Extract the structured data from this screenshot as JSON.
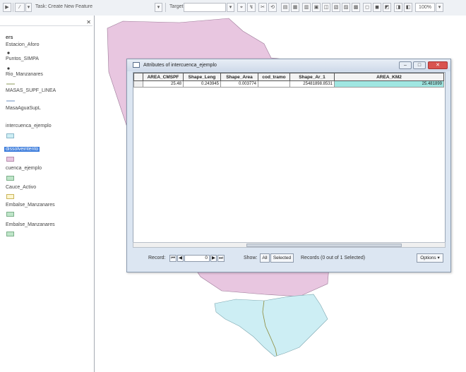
{
  "toolbar": {
    "task_label": "Task:",
    "task_value": "Create New Feature",
    "target_label": "Target:",
    "zoom_value": "100%"
  },
  "toc": {
    "header_label": "ers",
    "layers": [
      {
        "label": "Estacion_Aforo",
        "symbol": "none"
      },
      {
        "label": "Puntos_SIMPA",
        "symbol": "point"
      },
      {
        "label": "Rio_Manzanares",
        "symbol": "point"
      },
      {
        "label": "MASAS_SUPF_LINEA",
        "symbol": "line"
      },
      {
        "label": "MasaAguaSupL",
        "symbol": "line"
      },
      {
        "label": "intercuenca_ejemplo",
        "symbol": "poly-lightblue"
      },
      {
        "label": "dissolveintento",
        "symbol": "poly-pink",
        "selected": true
      },
      {
        "label": "cuenca_ejemplo",
        "symbol": "poly-green"
      },
      {
        "label": "Cauce_Activo",
        "symbol": "poly-yellow"
      },
      {
        "label": "Embalse_Manzanares",
        "symbol": "poly-green"
      },
      {
        "label": "Embalse_Manzanares",
        "symbol": "poly-green"
      }
    ]
  },
  "attr_window": {
    "title": "Attributes of intercuenca_ejemplo",
    "columns": [
      "AREA_CMSPF",
      "Shape_Leng",
      "Shape_Area",
      "cod_tramo",
      "Shape_Ar_1",
      "AREA_KM2"
    ],
    "rows": [
      [
        "25.48",
        "0.243945",
        "0.003774",
        "",
        "25481898.8531",
        "25.481899"
      ]
    ],
    "nav": {
      "record_label": "Record:",
      "record_value": "0",
      "show_label": "Show:",
      "show_all": "All",
      "show_selected": "Selected",
      "records_status": "Records (0 out of 1 Selected)",
      "options_label": "Options"
    }
  },
  "colors": {
    "pink_polygon": "#e8c6e0",
    "blue_polygon": "#cdeef4",
    "selected_layer": "#3d7ddc",
    "highlight_cell": "#9fe6e1"
  }
}
